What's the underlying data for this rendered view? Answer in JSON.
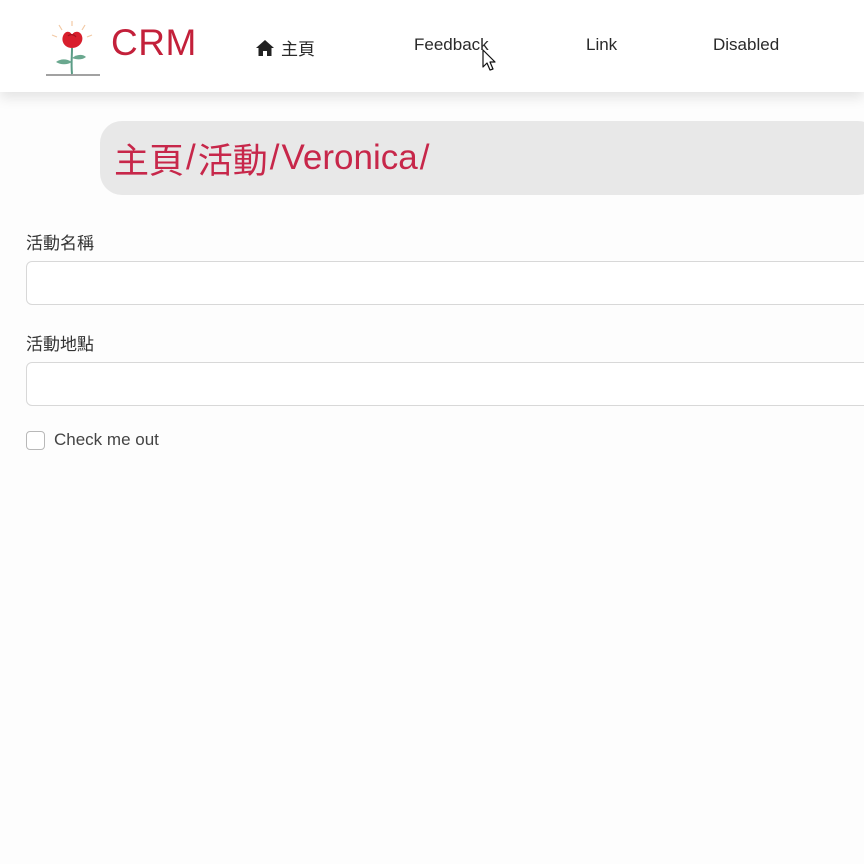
{
  "navbar": {
    "brand": "CRM",
    "links": [
      {
        "label": "主頁",
        "icon": "home-icon"
      },
      {
        "label": "Feedback"
      },
      {
        "label": "Link"
      },
      {
        "label": "Disabled"
      }
    ]
  },
  "breadcrumb": {
    "items": [
      "主頁",
      "活動",
      "Veronica"
    ],
    "separator": "/"
  },
  "form": {
    "name_label": "活動名稱",
    "name_value": "",
    "location_label": "活動地點",
    "location_value": "",
    "checkbox_label": "Check me out",
    "checkbox_checked": false
  },
  "colors": {
    "brand": "#c3203a",
    "breadcrumb_text": "#c7274a",
    "breadcrumb_bg": "#e8e8e8"
  }
}
